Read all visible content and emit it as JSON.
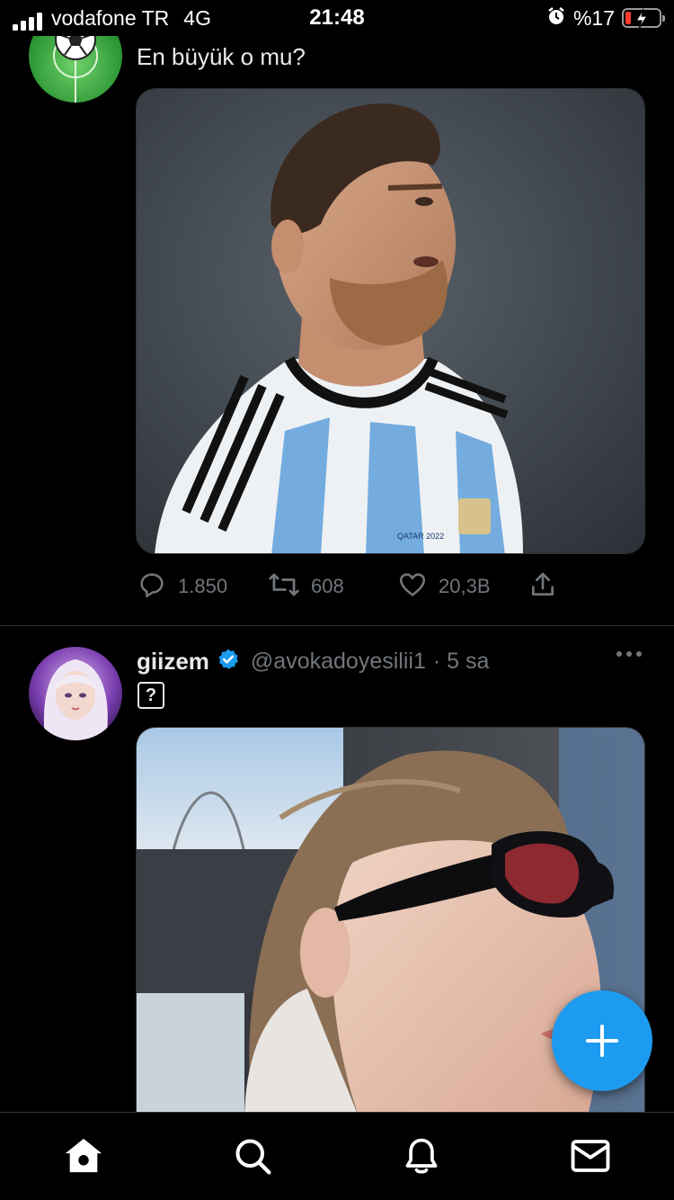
{
  "status_bar": {
    "carrier": "vodafone TR",
    "network": "4G",
    "time": "21:48",
    "battery": "%17",
    "icons": [
      "signal-bars-icon",
      "alarm-icon",
      "battery-charging-icon"
    ]
  },
  "tweets": [
    {
      "avatar": "football-account-avatar",
      "text": "En büyük o mu?",
      "media": "photo-football-player-argentina-jersey",
      "actions": {
        "replies": "1.850",
        "retweets": "608",
        "likes": "20,3B",
        "icons": [
          "reply-icon",
          "retweet-icon",
          "like-icon",
          "share-icon"
        ]
      }
    },
    {
      "avatar": "giizem-avatar",
      "name": "giizem",
      "verified": true,
      "handle": "@avokadoyesilii1",
      "time": "· 5 sa",
      "text_glyph": "?",
      "media": "photo-woman-sunglasses-in-car"
    }
  ],
  "fab": {
    "icon": "plus-icon",
    "color": "#1d9bf0"
  },
  "bottom_nav": {
    "items": [
      "home-icon",
      "search-icon",
      "notifications-icon",
      "messages-icon"
    ]
  },
  "colors": {
    "background": "#000000",
    "accent": "#1d9bf0",
    "secondary_text": "#71767b",
    "divider": "#2f3336"
  }
}
